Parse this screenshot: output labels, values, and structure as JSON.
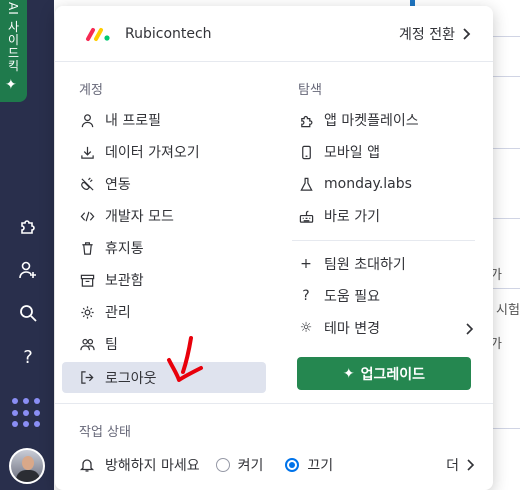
{
  "rail": {
    "ai_label": "AI 사이드킥",
    "icons": [
      "puzzle-icon",
      "add-user-icon",
      "search-icon",
      "help-icon",
      "apps-grid-icon"
    ],
    "help_glyph": "?"
  },
  "background": {
    "texts": [
      "가",
      "시험",
      "가"
    ]
  },
  "menu": {
    "brand_name": "Rubicontech",
    "switch_label": "계정 전환",
    "account_title": "계정",
    "account_items": [
      {
        "label": "내 프로필",
        "icon": "user-icon"
      },
      {
        "label": "데이터 가져오기",
        "icon": "download-icon"
      },
      {
        "label": "연동",
        "icon": "plug-icon"
      },
      {
        "label": "개발자 모드",
        "icon": "code-icon"
      },
      {
        "label": "휴지통",
        "icon": "trash-icon"
      },
      {
        "label": "보관함",
        "icon": "archive-icon"
      },
      {
        "label": "관리",
        "icon": "settings-icon"
      },
      {
        "label": "팀",
        "icon": "team-icon"
      },
      {
        "label": "로그아웃",
        "icon": "logout-icon"
      }
    ],
    "explore_title": "탐색",
    "explore_items": [
      {
        "label": "앱 마켓플레이스",
        "icon": "puzzle-icon"
      },
      {
        "label": "모바일 앱",
        "icon": "mobile-icon"
      },
      {
        "label": "monday.labs",
        "icon": "flask-icon"
      },
      {
        "label": "바로 가기",
        "icon": "keyboard-icon"
      }
    ],
    "more_items": [
      {
        "label": "팀원 초대하기",
        "icon": "plus-icon",
        "glyph": "+"
      },
      {
        "label": "도움 필요",
        "icon": "question-icon",
        "glyph": "?"
      },
      {
        "label": "테마 변경",
        "icon": "sun-icon",
        "glyph": "☼"
      }
    ],
    "upgrade_label": "업그레이드",
    "status_title": "작업 상태",
    "dnd_label": "방해하지 마세요",
    "on_label": "켜기",
    "off_label": "끄기",
    "off_selected": true,
    "more_label": "더",
    "colors": {
      "upgrade": "#258750",
      "radio": "#0073ea",
      "rail": "#292f4c",
      "highlight": "#dfe3ee"
    }
  }
}
